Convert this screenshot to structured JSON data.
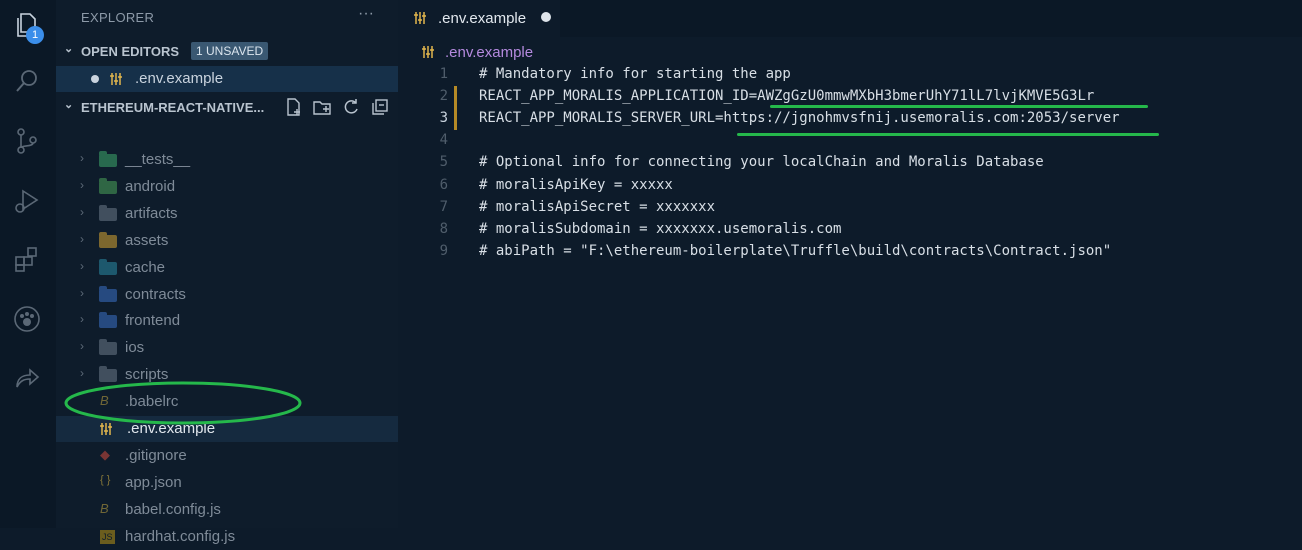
{
  "activity": {
    "badge_count": "1"
  },
  "sidebar": {
    "title": "EXPLORER",
    "more": "···",
    "open_editors": {
      "label": "OPEN EDITORS",
      "badge": "1 UNSAVED",
      "items": [
        {
          "label": ".env.example"
        }
      ]
    },
    "project": {
      "label": "ETHEREUM-REACT-NATIVE...",
      "items": [
        {
          "label": "__tests__",
          "kind": "folder",
          "color": "#3fa86b"
        },
        {
          "label": "android",
          "kind": "folder",
          "color": "#4aa35a"
        },
        {
          "label": "artifacts",
          "kind": "folder",
          "color": "#6c7a89"
        },
        {
          "label": "assets",
          "kind": "folder",
          "color": "#d6a531"
        },
        {
          "label": "cache",
          "kind": "folder",
          "color": "#2b8aa3"
        },
        {
          "label": "contracts",
          "kind": "folder",
          "color": "#3a70c6"
        },
        {
          "label": "frontend",
          "kind": "folder",
          "color": "#3a70c6"
        },
        {
          "label": "ios",
          "kind": "folder",
          "color": "#6c7a89"
        },
        {
          "label": "scripts",
          "kind": "folder",
          "color": "#6c7a89"
        },
        {
          "label": ".babelrc",
          "kind": "file",
          "icon": "babel-icon"
        },
        {
          "label": ".env.example",
          "kind": "file",
          "icon": "settings-icon"
        },
        {
          "label": ".gitignore",
          "kind": "file",
          "icon": "git-icon"
        },
        {
          "label": "app.json",
          "kind": "file",
          "icon": "json-icon"
        },
        {
          "label": "babel.config.js",
          "kind": "file",
          "icon": "babel-icon"
        },
        {
          "label": "hardhat.config.js",
          "kind": "file",
          "icon": "js-icon"
        }
      ]
    }
  },
  "editor": {
    "tab_label": ".env.example",
    "breadcrumb": ".env.example",
    "lines": [
      {
        "n": "1",
        "text": "# Mandatory info for starting the app"
      },
      {
        "n": "2",
        "text": "REACT_APP_MORALIS_APPLICATION_ID=AWZgGzU0mmwMXbH3bmerUhY71lL7lvjKMVE5G3Lr"
      },
      {
        "n": "3",
        "text": "REACT_APP_MORALIS_SERVER_URL=https://jgnohmvsfnij.usemoralis.com:2053/server"
      },
      {
        "n": "4",
        "text": ""
      },
      {
        "n": "5",
        "text": "# Optional info for connecting your localChain and Moralis Database"
      },
      {
        "n": "6",
        "text": "# moralisApiKey = xxxxx"
      },
      {
        "n": "7",
        "text": "# moralisApiSecret = xxxxxxx"
      },
      {
        "n": "8",
        "text": "# moralisSubdomain = xxxxxxx.usemoralis.com"
      },
      {
        "n": "9",
        "text": "# abiPath = \"F:\\ethereum-boilerplate\\Truffle\\build\\contracts\\Contract.json\""
      }
    ]
  },
  "colors": {
    "accent": "#3b8eea",
    "annotation": "#25b84b",
    "modified": "#b58a26"
  }
}
